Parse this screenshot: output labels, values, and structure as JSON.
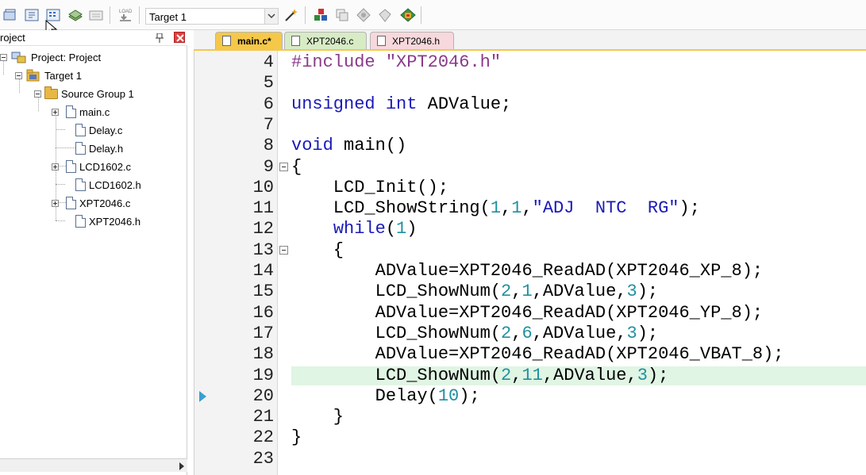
{
  "toolbar": {
    "target_select_value": "Target 1"
  },
  "project_panel": {
    "title": "roject",
    "tree": {
      "root": "Project: Project",
      "target": "Target 1",
      "group": "Source Group 1",
      "files": [
        "main.c",
        "Delay.c",
        "Delay.h",
        "LCD1602.c",
        "LCD1602.h",
        "XPT2046.c",
        "XPT2046.h"
      ]
    }
  },
  "tabs": [
    {
      "label": "main.c*",
      "active": true
    },
    {
      "label": "XPT2046.c",
      "active": false
    },
    {
      "label": "XPT2046.h",
      "active": false
    }
  ],
  "editor": {
    "current_line": "19",
    "lines": [
      {
        "n": "4",
        "tokens": [
          {
            "t": "#include ",
            "c": "pp"
          },
          {
            "t": "\"XPT2046.h\"",
            "c": "pp"
          }
        ]
      },
      {
        "n": "5",
        "tokens": []
      },
      {
        "n": "6",
        "tokens": [
          {
            "t": "unsigned int",
            "c": "kw"
          },
          {
            "t": " ADValue;",
            "c": ""
          }
        ]
      },
      {
        "n": "7",
        "tokens": []
      },
      {
        "n": "8",
        "tokens": [
          {
            "t": "void",
            "c": "kw"
          },
          {
            "t": " main()",
            "c": ""
          }
        ]
      },
      {
        "n": "9",
        "tokens": [
          {
            "t": "{",
            "c": ""
          }
        ]
      },
      {
        "n": "10",
        "tokens": [
          {
            "t": "    LCD_Init();",
            "c": ""
          }
        ]
      },
      {
        "n": "11",
        "tokens": [
          {
            "t": "    LCD_ShowString(",
            "c": ""
          },
          {
            "t": "1",
            "c": "num"
          },
          {
            "t": ",",
            "c": ""
          },
          {
            "t": "1",
            "c": "num"
          },
          {
            "t": ",",
            "c": ""
          },
          {
            "t": "\"ADJ  NTC  RG\"",
            "c": "str"
          },
          {
            "t": ");",
            "c": ""
          }
        ]
      },
      {
        "n": "12",
        "tokens": [
          {
            "t": "    ",
            "c": ""
          },
          {
            "t": "while",
            "c": "kw"
          },
          {
            "t": "(",
            "c": ""
          },
          {
            "t": "1",
            "c": "num"
          },
          {
            "t": ")",
            "c": ""
          }
        ]
      },
      {
        "n": "13",
        "tokens": [
          {
            "t": "    {",
            "c": ""
          }
        ]
      },
      {
        "n": "14",
        "tokens": [
          {
            "t": "        ADValue=XPT2046_ReadAD(XPT2046_XP_8);",
            "c": ""
          }
        ]
      },
      {
        "n": "15",
        "tokens": [
          {
            "t": "        LCD_ShowNum(",
            "c": ""
          },
          {
            "t": "2",
            "c": "num"
          },
          {
            "t": ",",
            "c": ""
          },
          {
            "t": "1",
            "c": "num"
          },
          {
            "t": ",ADValue,",
            "c": ""
          },
          {
            "t": "3",
            "c": "num"
          },
          {
            "t": ");",
            "c": ""
          }
        ]
      },
      {
        "n": "16",
        "tokens": [
          {
            "t": "        ADValue=XPT2046_ReadAD(XPT2046_YP_8);",
            "c": ""
          }
        ]
      },
      {
        "n": "17",
        "tokens": [
          {
            "t": "        LCD_ShowNum(",
            "c": ""
          },
          {
            "t": "2",
            "c": "num"
          },
          {
            "t": ",",
            "c": ""
          },
          {
            "t": "6",
            "c": "num"
          },
          {
            "t": ",ADValue,",
            "c": ""
          },
          {
            "t": "3",
            "c": "num"
          },
          {
            "t": ");",
            "c": ""
          }
        ]
      },
      {
        "n": "18",
        "tokens": [
          {
            "t": "        ADValue=XPT2046_ReadAD(XPT2046_VBAT_8);",
            "c": ""
          }
        ]
      },
      {
        "n": "19",
        "tokens": [
          {
            "t": "        LCD_ShowNum(",
            "c": ""
          },
          {
            "t": "2",
            "c": "num"
          },
          {
            "t": ",",
            "c": ""
          },
          {
            "t": "11",
            "c": "num"
          },
          {
            "t": ",ADValue,",
            "c": ""
          },
          {
            "t": "3",
            "c": "num"
          },
          {
            "t": ");",
            "c": ""
          }
        ]
      },
      {
        "n": "20",
        "tokens": [
          {
            "t": "        Delay(",
            "c": ""
          },
          {
            "t": "10",
            "c": "num"
          },
          {
            "t": ");",
            "c": ""
          }
        ]
      },
      {
        "n": "21",
        "tokens": [
          {
            "t": "    }",
            "c": ""
          }
        ]
      },
      {
        "n": "22",
        "tokens": [
          {
            "t": "}",
            "c": ""
          }
        ]
      },
      {
        "n": "23",
        "tokens": []
      }
    ]
  },
  "colors": {
    "active_tab": "#f5c84a",
    "c_tab": "#d7ebc5",
    "h_tab": "#f7d8dc",
    "keyword": "#1a1ab8",
    "number": "#2090a0",
    "current_line": "#e0f5e4"
  },
  "icons": [
    "build-icon",
    "rebuild-icon",
    "batch-build-icon",
    "stop-build-icon",
    "download-icon",
    "load-icon",
    "magic-wand-icon",
    "manage-components-icon",
    "pack-installer-icon",
    "select-packs-icon",
    "manage-rte-icon",
    "copy-icon"
  ]
}
